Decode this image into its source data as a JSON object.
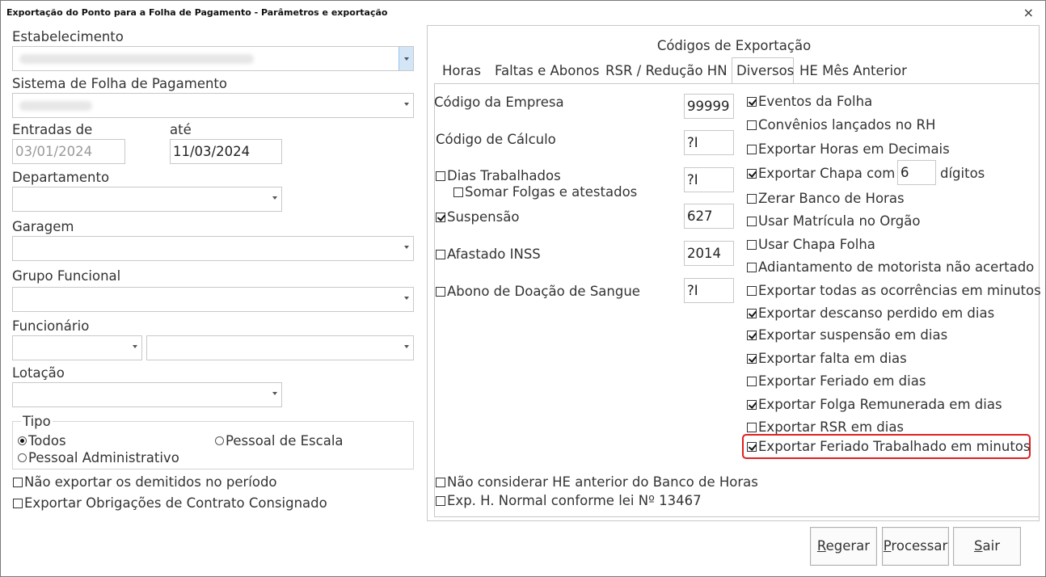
{
  "window": {
    "title": "Exportação do Ponto para a Folha de Pagamento - Parâmetros e exportação",
    "close": "×"
  },
  "left": {
    "estabelecimento_label": "Estabelecimento",
    "sistema_label": "Sistema de Folha de Pagamento",
    "entradas_de_label": "Entradas de",
    "ate_label": "até",
    "entradas_de_value": "03/01/2024",
    "ate_value": "11/03/2024",
    "departamento_label": "Departamento",
    "garagem_label": "Garagem",
    "grupo_funcional_label": "Grupo Funcional",
    "funcionario_label": "Funcionário",
    "lotacao_label": "Lotação",
    "tipo": {
      "legend": "Tipo",
      "options": [
        "Todos",
        "Pessoal de Escala",
        "Pessoal Administrativo"
      ],
      "selected": "Todos"
    },
    "nao_exportar_demitidos": {
      "label": "Não exportar os demitidos no período",
      "checked": false
    },
    "exportar_obrigacoes": {
      "label": "Exportar Obrigações de Contrato Consignado",
      "checked": false
    }
  },
  "right": {
    "title": "Códigos de Exportação",
    "tabs": [
      "Horas",
      "Faltas e Abonos",
      "RSR / Redução HN",
      "Diversos",
      "HE Mês Anterior"
    ],
    "active_tab": "Diversos",
    "codigo_empresa": {
      "label": "Código da Empresa",
      "value": "99999"
    },
    "codigo_calculo": {
      "label": "Código de Cálculo",
      "value": "?I"
    },
    "dias_trabalhados": {
      "label": "Dias Trabalhados",
      "checked": false,
      "value": "?I"
    },
    "somar_folgas": {
      "label": "Somar Folgas e atestados",
      "checked": false
    },
    "suspensao": {
      "label": "Suspensão",
      "checked": true,
      "value": "627"
    },
    "afastado_inss": {
      "label": "Afastado INSS",
      "checked": false,
      "value": "2014"
    },
    "abono_doacao": {
      "label": "Abono de Doação de Sangue",
      "checked": false,
      "value": "?I"
    },
    "options": [
      {
        "label": "Eventos da Folha",
        "checked": true
      },
      {
        "label": "Convênios lançados no RH",
        "checked": false
      },
      {
        "label": "Exportar Horas em Decimais",
        "checked": false
      },
      {
        "label": "Exportar Chapa com",
        "checked": true
      },
      {
        "label": "Zerar Banco de Horas",
        "checked": false
      },
      {
        "label": "Usar Matrícula no Orgão",
        "checked": false
      },
      {
        "label": "Usar Chapa Folha",
        "checked": false
      },
      {
        "label": "Adiantamento de motorista não acertado",
        "checked": false
      },
      {
        "label": "Exportar todas as ocorrências em minutos",
        "checked": false
      },
      {
        "label": "Exportar descanso perdido em dias",
        "checked": true
      },
      {
        "label": "Exportar suspensão em dias",
        "checked": true
      },
      {
        "label": "Exportar falta em dias",
        "checked": true
      },
      {
        "label": "Exportar Feriado em dias",
        "checked": false
      },
      {
        "label": "Exportar Folga Remunerada em dias",
        "checked": true
      },
      {
        "label": "Exportar RSR em dias",
        "checked": false
      },
      {
        "label": "Exportar Feriado Trabalhado em minutos",
        "checked": true
      }
    ],
    "chapa_digits_value": "6",
    "chapa_digits_suffix": "dígitos",
    "nao_considerar_he": {
      "label": "Não considerar HE anterior do Banco de Horas",
      "checked": false
    },
    "exp_h_normal": {
      "label": "Exp. H. Normal conforme lei Nº 13467",
      "checked": false
    }
  },
  "buttons": {
    "regerar": {
      "underline": "R",
      "rest": "egerar"
    },
    "processar": {
      "underline": "P",
      "rest": "rocessar"
    },
    "sair": {
      "underline": "S",
      "rest": "air"
    }
  }
}
